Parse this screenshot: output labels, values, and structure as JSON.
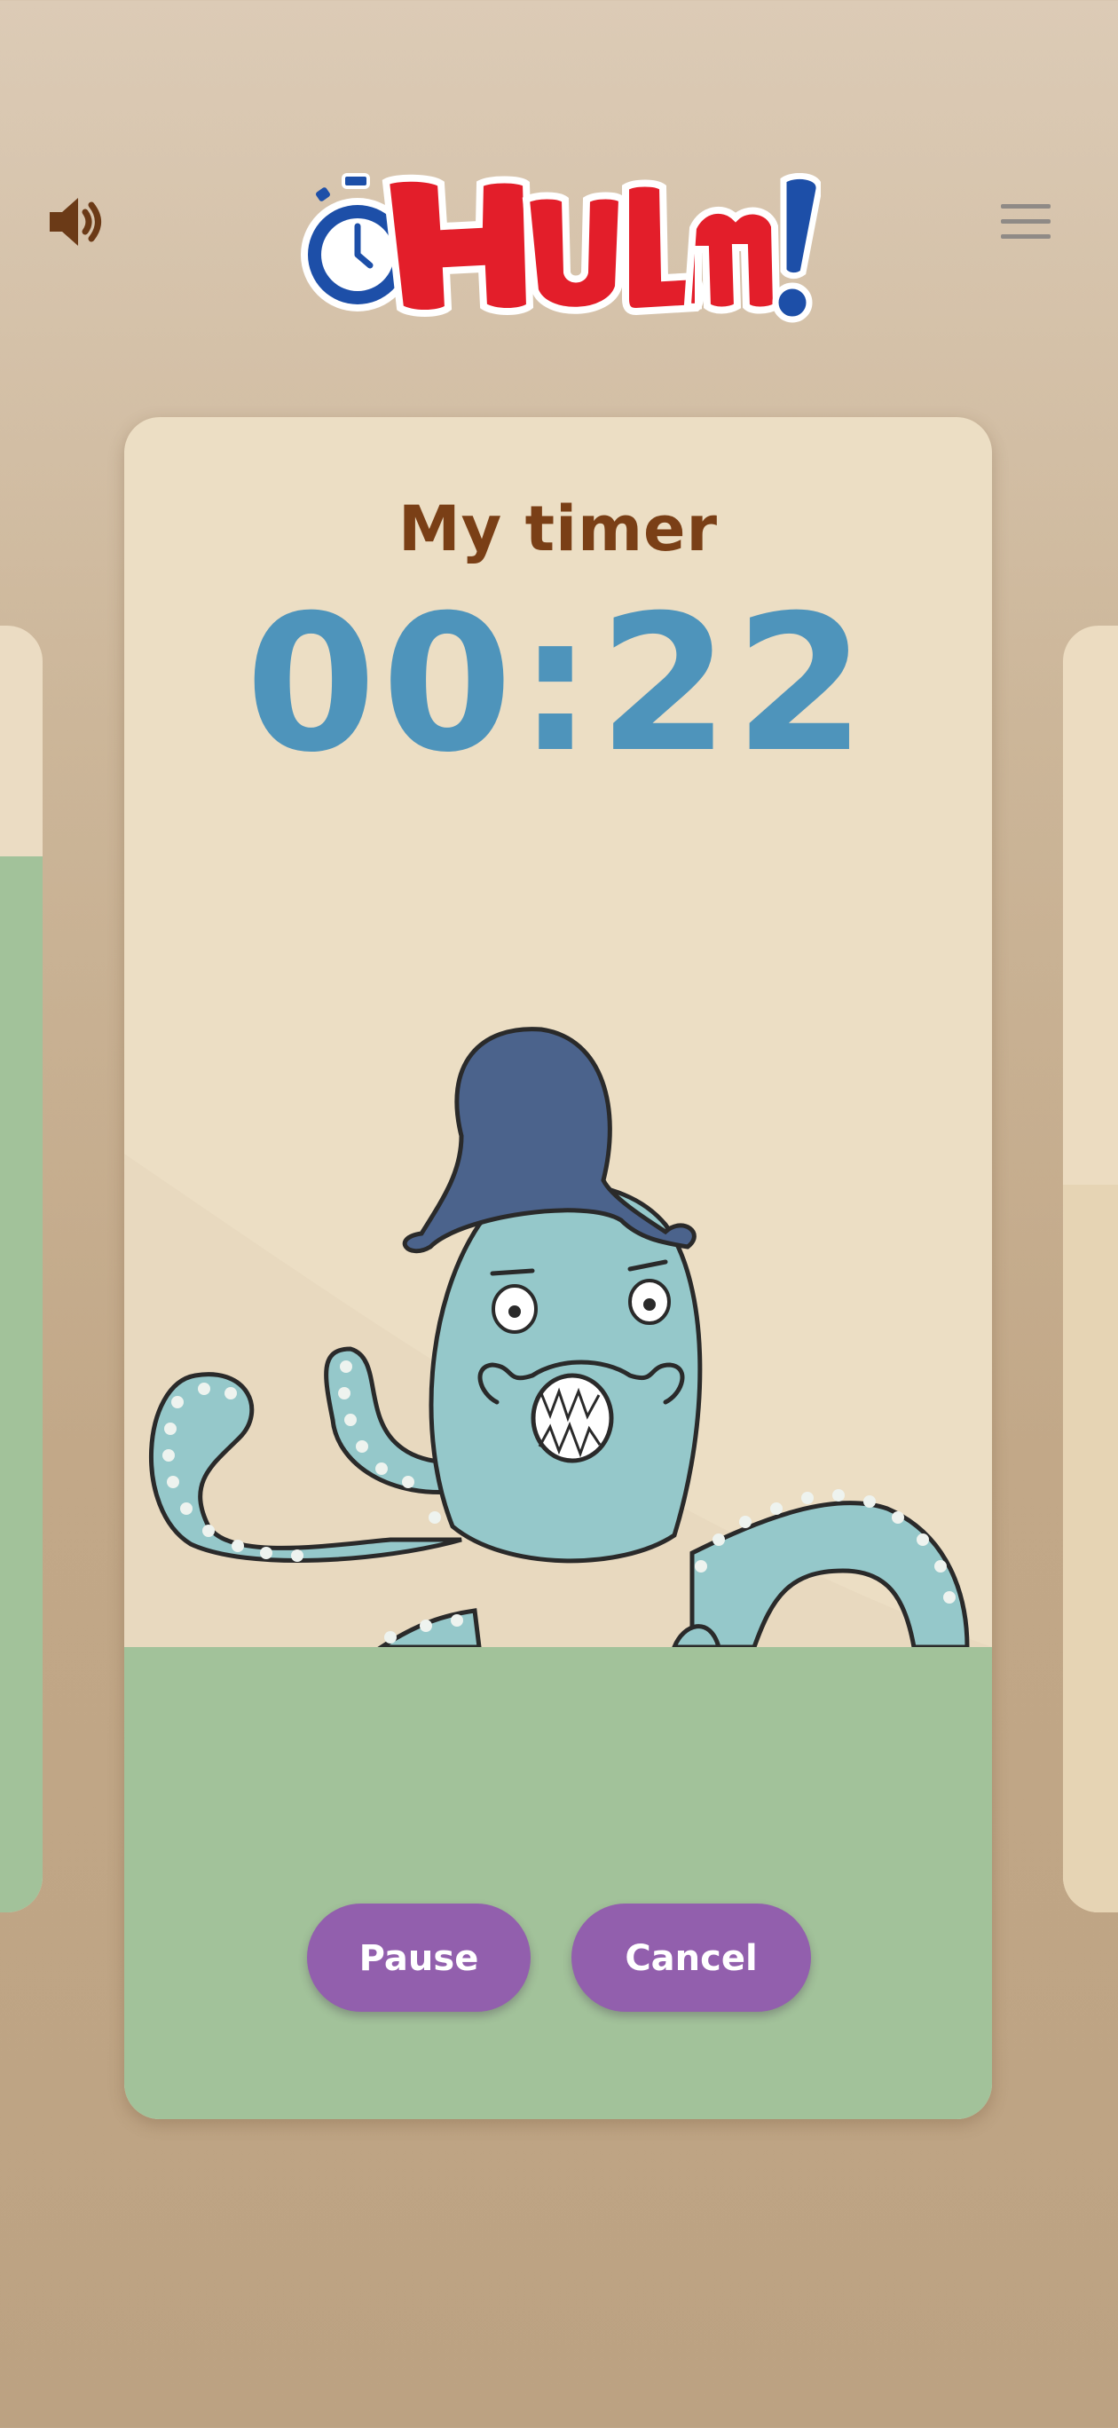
{
  "header": {
    "sound_icon": "speaker-icon",
    "menu_icon": "hamburger-menu-icon",
    "logo": {
      "text": "HULM!",
      "colors": {
        "stopwatch": "#1d4fa8",
        "letters": "#e31e2a",
        "exclamation": "#1d4fa8",
        "outline": "#ffffff"
      }
    }
  },
  "timer_card": {
    "title": "My timer",
    "time": "00:22",
    "illustration": "octopus-with-hat",
    "buttons": {
      "pause": "Pause",
      "cancel": "Cancel"
    }
  },
  "colors": {
    "title": "#7a3f16",
    "time": "#4e94bb",
    "button": "#925fad",
    "card_background": "#ecdec4",
    "ground": "#a2c29a",
    "icon_brown": "#6b3a17"
  }
}
